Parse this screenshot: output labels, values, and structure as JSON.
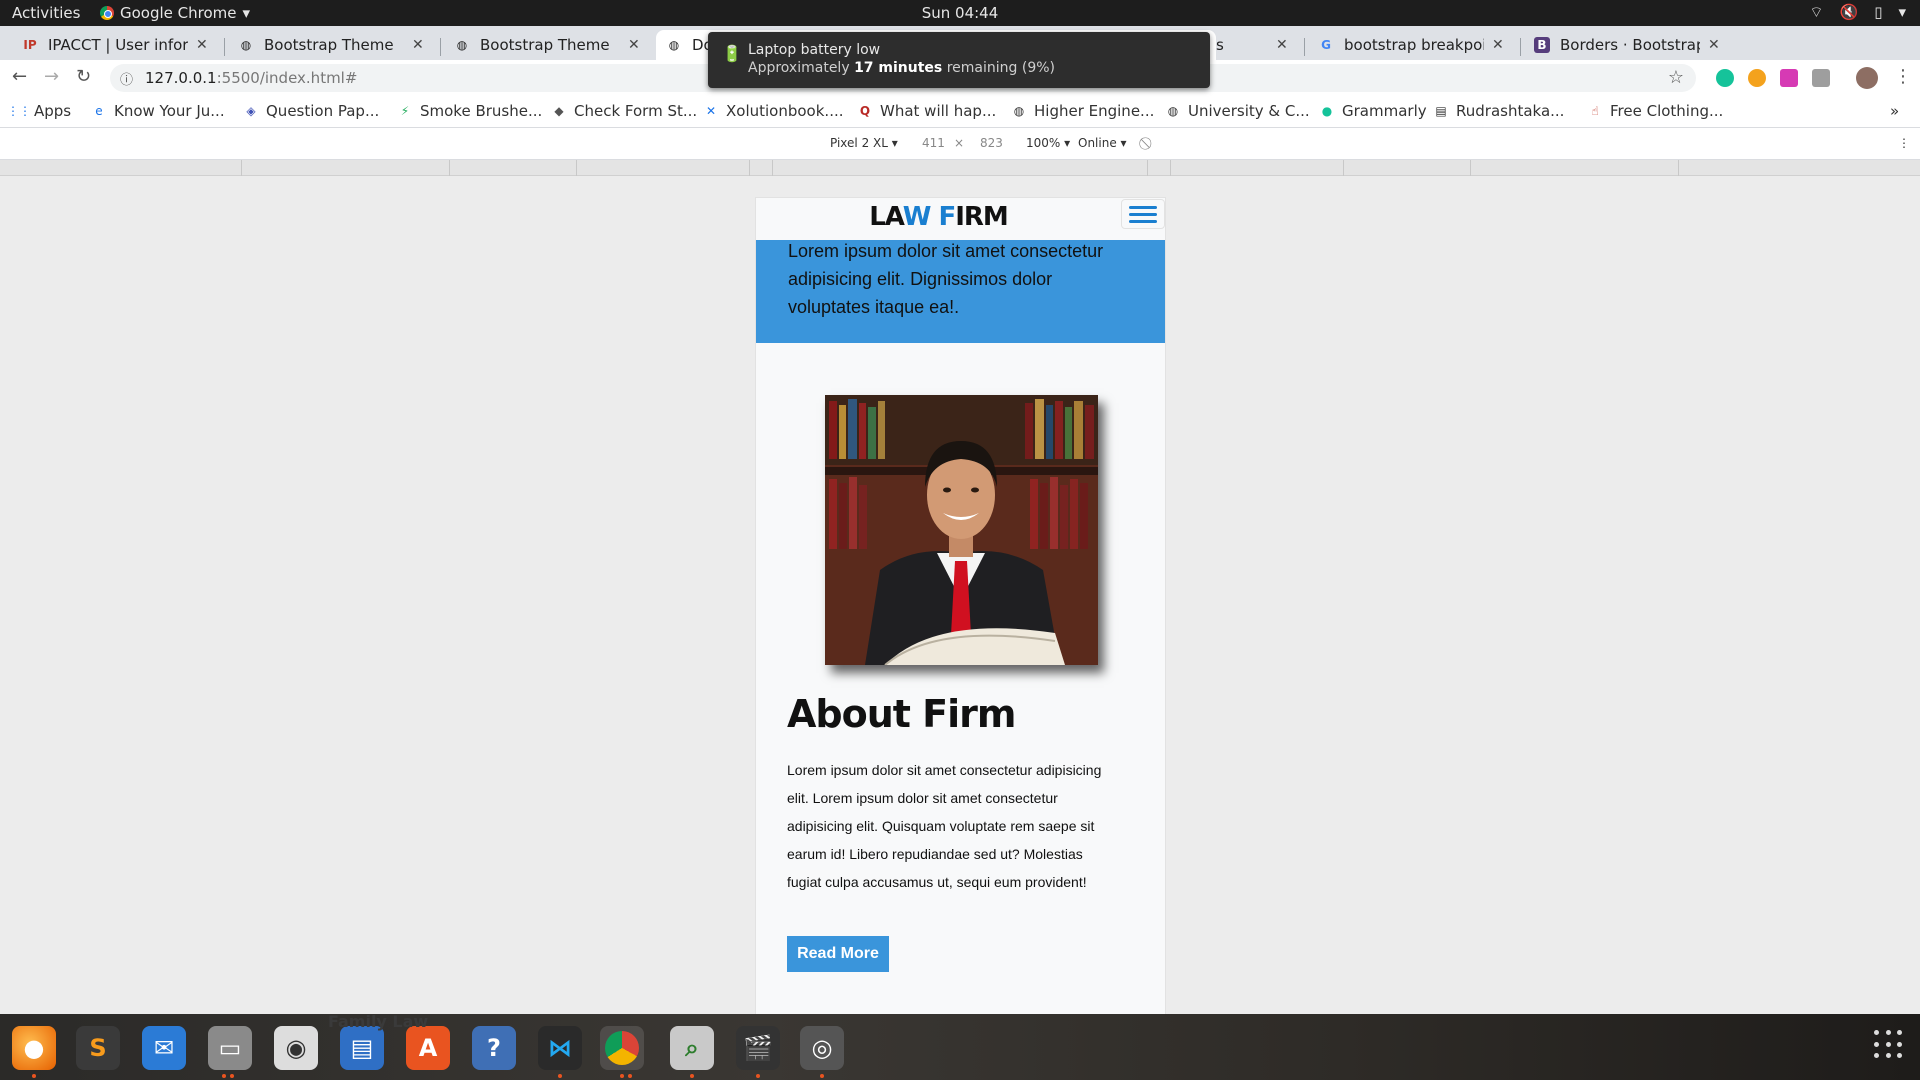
{
  "topbar": {
    "activities": "Activities",
    "app_name": "Google Chrome",
    "clock": "Sun 04:44"
  },
  "tabs": [
    {
      "title": "IPACCT | User informa",
      "favicon": "ipacct-logo-icon"
    },
    {
      "title": "Bootstrap Theme",
      "favicon": "globe-icon"
    },
    {
      "title": "Bootstrap Theme",
      "favicon": "globe-icon"
    },
    {
      "title": "Do",
      "favicon": "globe-icon",
      "active": true
    },
    {
      "title": "s",
      "favicon": ""
    },
    {
      "title": "bootstrap breakpoint",
      "favicon": "google-g-icon"
    },
    {
      "title": "Borders · Bootstrap",
      "favicon": "bootstrap-b-icon"
    }
  ],
  "address": {
    "host": "127.0.0.1",
    "path": ":5500/index.html#"
  },
  "bookmarks": [
    {
      "label": "Apps",
      "icon": "apps-grid-icon"
    },
    {
      "label": "Know Your Ju...",
      "icon": "edge-e-icon"
    },
    {
      "label": "Question Pap...",
      "icon": "shield-crest-icon"
    },
    {
      "label": "Smoke Brushe...",
      "icon": "leaf-icon"
    },
    {
      "label": "Check Form St...",
      "icon": "diamond-icon"
    },
    {
      "label": "Xolutionbook....",
      "icon": "x-icon"
    },
    {
      "label": "What will hap...",
      "icon": "quora-q-icon"
    },
    {
      "label": "Higher Engine...",
      "icon": "globe-icon"
    },
    {
      "label": "University & C...",
      "icon": "globe-icon"
    },
    {
      "label": "Grammarly",
      "icon": "grammarly-icon"
    },
    {
      "label": "Rudrashtaka...",
      "icon": "book-icon"
    },
    {
      "label": "Free Clothing...",
      "icon": "hand-icon"
    }
  ],
  "devtools": {
    "device": "Pixel 2 XL ▾",
    "width": "411",
    "times": "×",
    "height": "823",
    "zoom": "100% ▾",
    "network": "Online ▾"
  },
  "notification": {
    "title": "Laptop battery low",
    "body_prefix": "Approximately ",
    "body_bold": "17 minutes",
    "body_suffix": " remaining (9%)"
  },
  "site": {
    "brand_part1": "LA",
    "brand_accent1": "W",
    "brand_space": " ",
    "brand_accent2": "F",
    "brand_part2": "IRM",
    "hero_text": "Lorem ipsum dolor sit amet consectetur adipisicing elit. Dignissimos dolor voluptates itaque ea!.",
    "about_title": "About Firm",
    "about_text": "Lorem ipsum dolor sit amet consectetur adipisicing elit. Lorem ipsum dolor sit amet consectetur adipisicing elit. Quisquam voluptate rem saepe sit earum id! Libero repudiandae sed ut? Molestias fugiat culpa accusamus ut, sequi eum provident!",
    "read_more": "Read More"
  },
  "dock": {
    "hover_label": "Family Law"
  },
  "colors": {
    "accent": "#1a7fd0",
    "hero_bg": "#3a95db",
    "button_bg": "#3a95db"
  }
}
